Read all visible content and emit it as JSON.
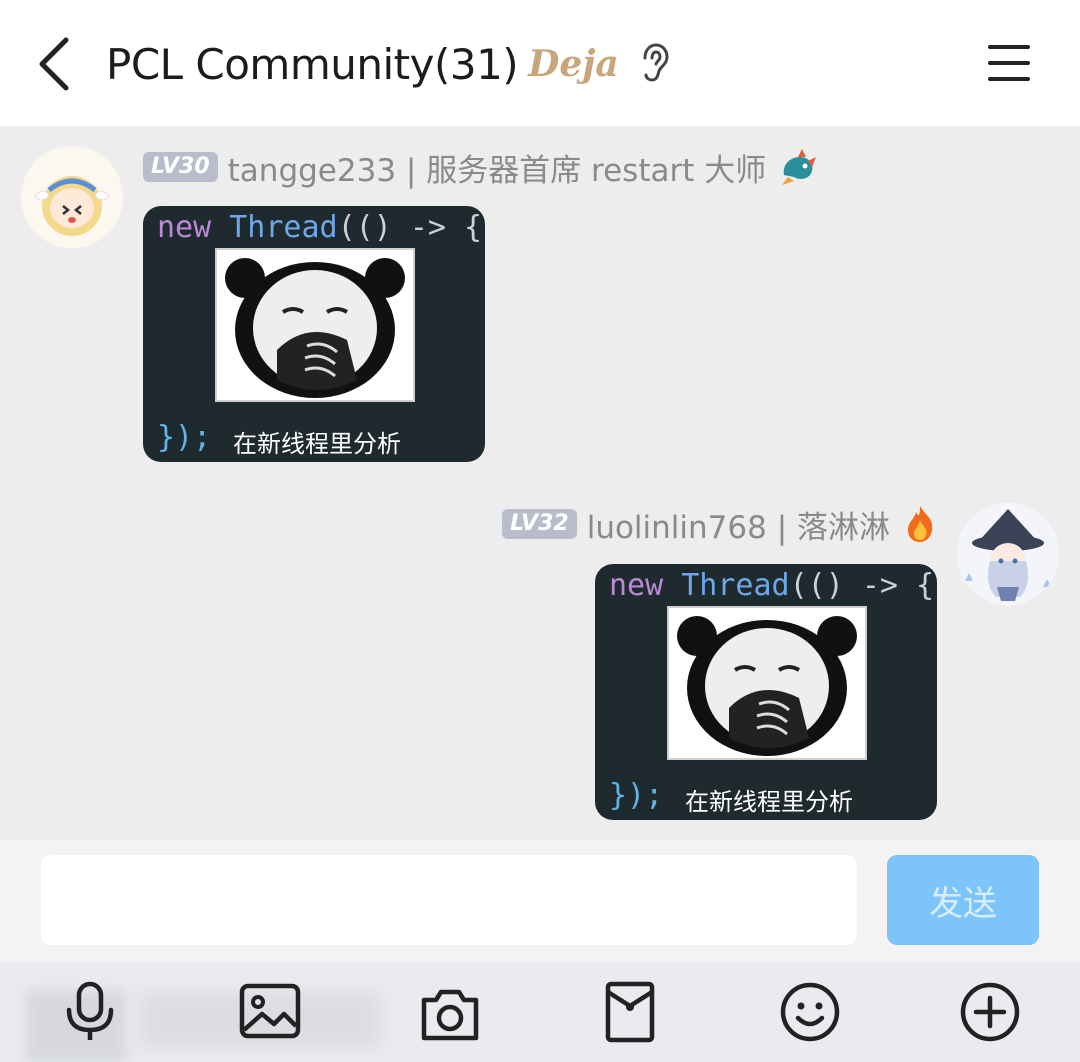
{
  "header": {
    "title": "PCL Community(31)",
    "badge_text": "Deja",
    "back_icon": "chevron-left-icon",
    "ear_icon": "ear-icon",
    "menu_icon": "hamburger-menu-icon"
  },
  "messages": [
    {
      "side": "left",
      "level": "LV30",
      "sender": "tangge233 | 服务器首席 restart 大师",
      "badge_icon": "dragon-icon",
      "meme": {
        "code_new": "new",
        "code_thread": "Thread",
        "code_rest": "(() -> {",
        "code_end": "});",
        "caption": "在新线程里分析"
      }
    },
    {
      "side": "right",
      "level": "LV32",
      "sender": "luolinlin768 | 落淋淋",
      "badge_icon": "fire-icon",
      "meme": {
        "code_new": "new",
        "code_thread": "Thread",
        "code_rest": "(() -> {",
        "code_end": "});",
        "caption": "在新线程里分析"
      }
    }
  ],
  "composer": {
    "input_value": "",
    "send_label": "发送"
  },
  "toolbar": {
    "items": [
      "microphone-icon",
      "image-icon",
      "camera-icon",
      "red-packet-icon",
      "emoji-icon",
      "plus-circle-icon"
    ]
  },
  "colors": {
    "header_bg": "#ffffff",
    "chat_bg": "#ededed",
    "send_button": "#7cc4fa",
    "level_badge": "#b9bccb",
    "meme_bg": "#1f2a2e"
  }
}
